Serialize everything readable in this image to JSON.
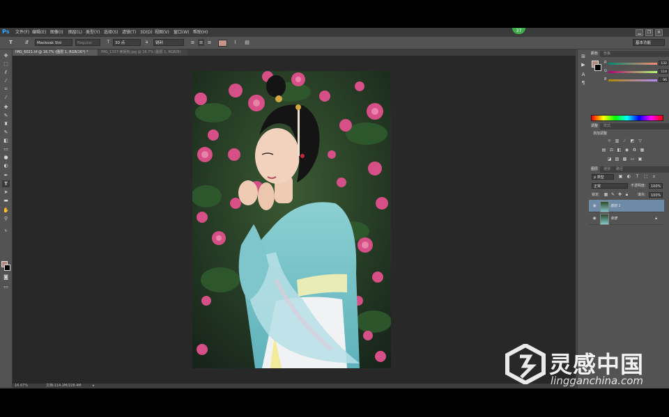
{
  "menubar": {
    "logo": "Ps",
    "items": [
      "文件(F)",
      "编辑(E)",
      "图像(I)",
      "图层(L)",
      "类型(Y)",
      "选择(S)",
      "滤镜(T)",
      "3D(D)",
      "视图(V)",
      "窗口(W)",
      "帮助(H)"
    ],
    "badge": "37",
    "window_controls": [
      "▁",
      "❐",
      "✕"
    ]
  },
  "options": {
    "tool_icon": "T",
    "font_family": "Mackoak Std",
    "font_style": "Regular",
    "font_size": "30 点",
    "aa_label": "a",
    "aa_mode": "锐利",
    "text_color": "#c2948a",
    "workspace": "基本功能"
  },
  "tabs": [
    {
      "label": "IMG_6021.tif @ 16.7% (图层 1, RGB/16*) *",
      "active": true
    },
    {
      "label": "IMG_1337-焦距粉.jpg @ 16.7% (图层 1, RGB/8)",
      "active": false
    }
  ],
  "status": {
    "zoom": "16.67%",
    "doc_size": "文档:114.2M/228.4M"
  },
  "color_panel": {
    "tabs": [
      "颜色",
      "色板"
    ],
    "channels": [
      {
        "label": "R",
        "value": "132"
      },
      {
        "label": "G",
        "value": "114"
      },
      {
        "label": "B",
        "value": "96"
      }
    ],
    "foreground": "#b08a7e"
  },
  "adjust_panel": {
    "tabs": [
      "调整",
      "样式"
    ],
    "title": "添加调整"
  },
  "layers_panel": {
    "tabs": [
      "图层",
      "通道",
      "路径"
    ],
    "filter": "ρ 类型",
    "blend_mode": "正常",
    "opacity_label": "不透明度:",
    "opacity": "100%",
    "lock_label": "锁定:",
    "fill_label": "填充:",
    "fill": "100%",
    "layers": [
      {
        "name": "图层 1",
        "selected": true,
        "locked": false
      },
      {
        "name": "背景",
        "selected": false,
        "locked": true
      }
    ]
  },
  "watermark": {
    "cn": "灵感中国",
    "en": "lingganchina.com"
  }
}
